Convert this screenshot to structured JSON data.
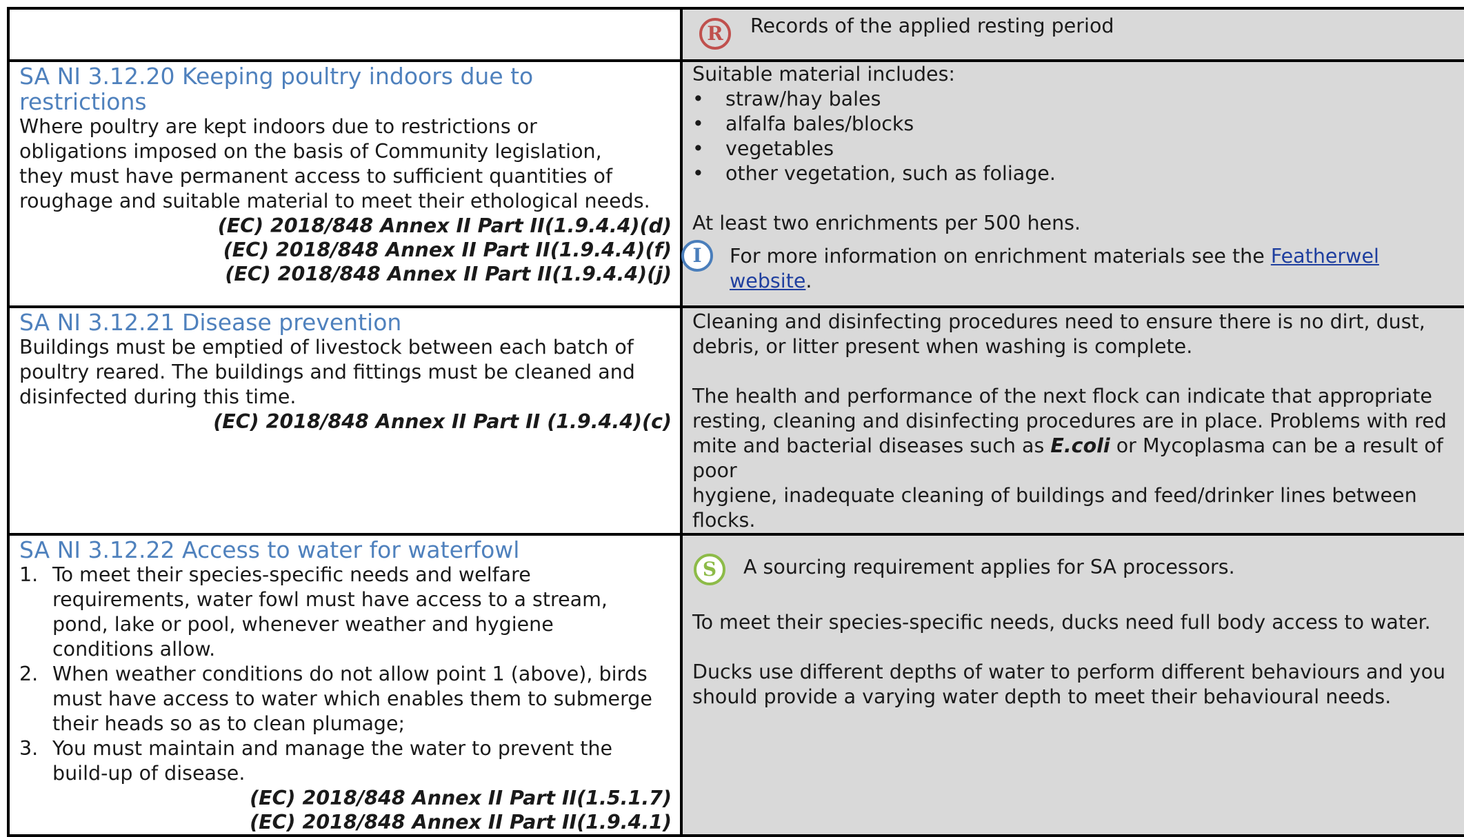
{
  "row1": {
    "records_text": "Records of the applied resting period",
    "icon": "R"
  },
  "row2": {
    "heading_line1": "SA NI 3.12.20 Keeping poultry indoors due to",
    "heading_line2": "restrictions",
    "body_lines": [
      "Where poultry are kept indoors due to restrictions or",
      "obligations imposed on the basis of Community legislation,",
      "they must have permanent access to sufficient quantities of",
      "roughage and suitable material to meet their ethological needs."
    ],
    "refs": [
      "(EC) 2018/848 Annex II Part II(1.9.4.4)(d)",
      "(EC) 2018/848 Annex II Part II(1.9.4.4)(f)",
      "(EC) 2018/848 Annex II Part II(1.9.4.4)(j)"
    ],
    "guidance_intro": "Suitable material includes:",
    "guidance_bullets": [
      "straw/hay bales",
      "alfalfa bales/blocks",
      "vegetables",
      "other vegetation, such as foliage."
    ],
    "enrichment_text": "At least two enrichments per 500 hens.",
    "info_icon": "I",
    "info_text": "For more information on enrichment materials see the",
    "info_link_1": "Featherwel",
    "info_link_2": "website",
    "info_end": "."
  },
  "row3": {
    "heading": "SA NI 3.12.21 Disease prevention",
    "body_lines": [
      "Buildings must be emptied of livestock between each batch of",
      "poultry reared. The buildings and fittings must be cleaned and",
      "disinfected during this time."
    ],
    "ref": "(EC) 2018/848 Annex II Part II (1.9.4.4)(c)",
    "guidance_p1_lines": [
      "Cleaning and disinfecting procedures need to ensure there is no dirt, dust,",
      "debris, or litter present when washing is complete."
    ],
    "guidance_p2_lines": [
      "The health and performance of the next flock can indicate that appropriate",
      "resting, cleaning and disinfecting procedures are in place. Problems with red"
    ],
    "guidance_p2_line3_a": "mite and bacterial diseases such as ",
    "guidance_p2_line3_italic": "E.coli",
    "guidance_p2_line3_b": " or Mycoplasma can be a result of poor",
    "guidance_p2_tail_lines": [
      "hygiene, inadequate cleaning of buildings and feed/drinker lines between",
      "flocks."
    ]
  },
  "row4": {
    "heading": "SA NI 3.12.22 Access to water for waterfowl",
    "items": [
      {
        "num": "1.",
        "lines": [
          "To meet their species-specific needs and welfare",
          "requirements, water fowl must have access to a stream,",
          "pond, lake or pool, whenever weather and hygiene",
          "conditions allow."
        ]
      },
      {
        "num": "2.",
        "lines": [
          "When weather conditions do not allow point 1 (above), birds",
          "must have access to water which enables them to submerge",
          "their heads so as to clean plumage;"
        ]
      },
      {
        "num": "3.",
        "lines": [
          "You must maintain and manage the water to prevent the",
          "build-up of disease."
        ]
      }
    ],
    "refs": [
      "(EC) 2018/848 Annex II Part II(1.5.1.7)",
      "(EC) 2018/848 Annex II Part II(1.9.4.1)"
    ],
    "sourcing_icon": "S",
    "sourcing_text": "A sourcing requirement applies for SA processors.",
    "guidance_p1": "To meet their species-specific needs, ducks need full body access to water.",
    "guidance_p2_lines": [
      "Ducks use different depths of water to perform different behaviours and you",
      "should provide a varying water depth to meet their behavioural needs."
    ]
  },
  "colors": {
    "heading": "#4f81bd",
    "guidance_background": "#d9d9d9",
    "records_icon": "#c0504d",
    "info_icon": "#4a7ebb",
    "sourcing_icon": "#8dbb48",
    "link": "#1f3f9f"
  },
  "icons": {
    "records": "records-r-icon",
    "info": "information-i-icon",
    "sourcing": "sourcing-s-icon"
  }
}
